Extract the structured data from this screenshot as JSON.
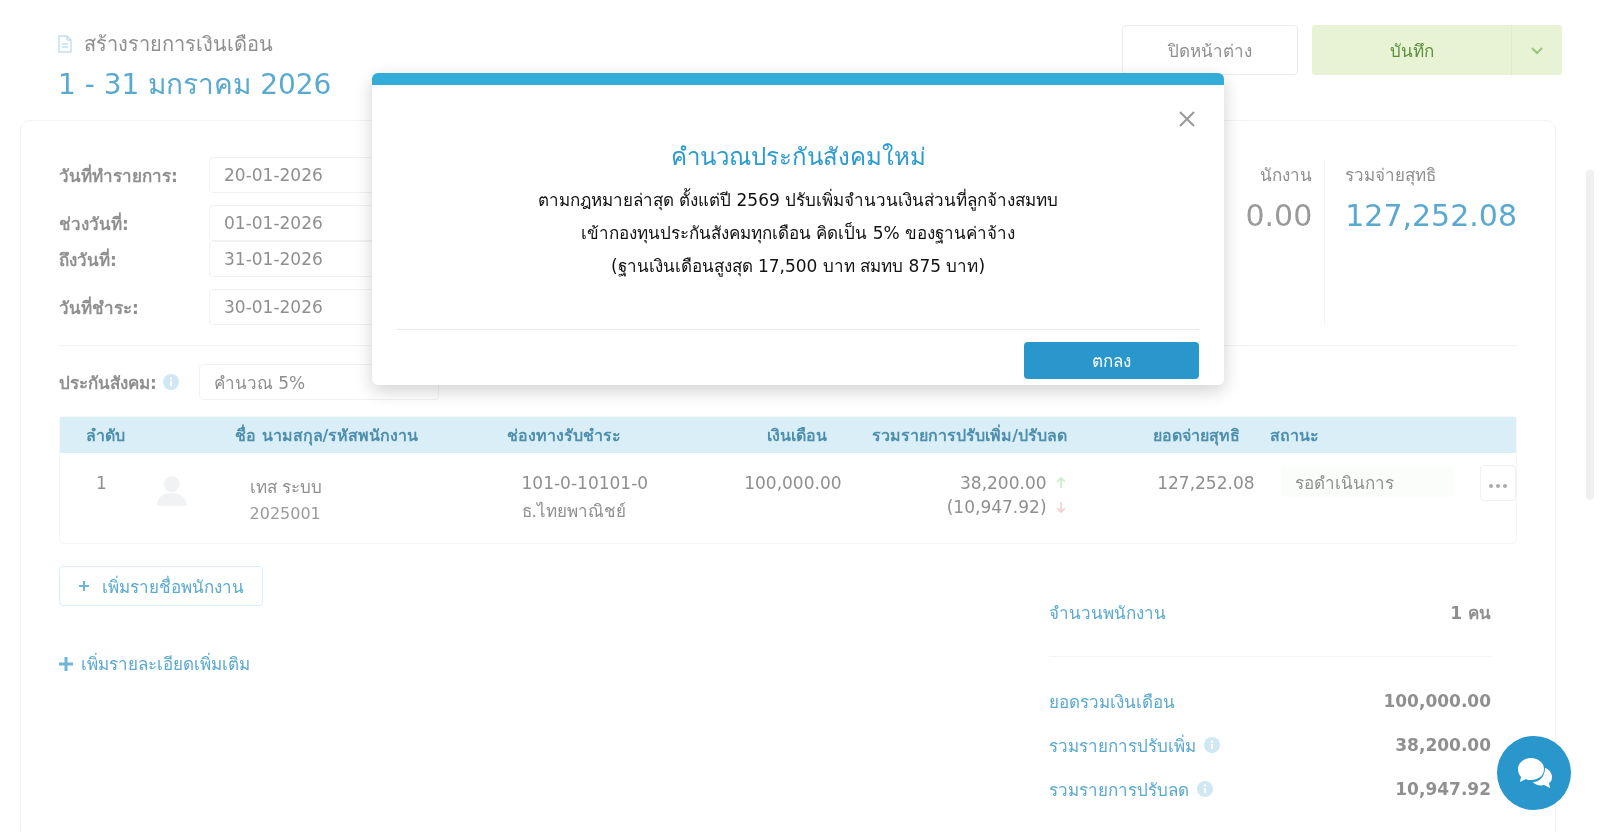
{
  "header": {
    "doc_title": "สร้างรายการเงินเดือน",
    "period": "1 - 31 มกราคม 2026"
  },
  "buttons": {
    "close_label": "ปิดหน้าต่าง",
    "save_label": "บันทึก"
  },
  "form": {
    "fields": [
      {
        "label": "วันที่ทำรายการ:",
        "value": "20-01-2026"
      },
      {
        "label": "ช่วงวันที่:",
        "value": "01-01-2026"
      },
      {
        "label": "ถึงวันที่:",
        "value": "31-01-2026"
      },
      {
        "label": "วันที่ชำระ:",
        "value": "30-01-2026"
      }
    ],
    "social_security": {
      "label": "ประกันสังคม:",
      "value": "คำนวณ 5%"
    }
  },
  "stats": [
    {
      "label": "นักงาน",
      "value": "0.00",
      "highlight": false
    },
    {
      "label": "รวมจ่ายสุทธิ",
      "value": "127,252.08",
      "highlight": true
    }
  ],
  "table": {
    "columns": [
      "ลำดับ",
      "ชื่อ นามสกุล/รหัสพนักงาน",
      "ช่องทางรับชำระ",
      "เงินเดือน",
      "รวมรายการปรับเพิ่ม/ปรับลด",
      "ยอดจ่ายสุทธิ",
      "สถานะ"
    ],
    "rows": [
      {
        "no": "1",
        "name": "เทส ระบบ",
        "code": "2025001",
        "account": "101-0-10101-0",
        "bank": "ธ.ไทยพาณิชย์",
        "salary": "100,000.00",
        "increase": "38,200.00",
        "decrease": "(10,947.92)",
        "net": "127,252.08",
        "status": "รอดำเนินการ"
      }
    ]
  },
  "add_employee_button": "เพิ่มรายชื่อพนักงาน",
  "add_details_link": "เพิ่มรายละเอียดเพิ่มเติม",
  "summary": [
    {
      "label": "จำนวนพนักงาน",
      "value": "1 คน",
      "info": false
    },
    {
      "label": "ยอดรวมเงินเดือน",
      "value": "100,000.00",
      "info": false
    },
    {
      "label": "รวมรายการปรับเพิ่ม",
      "value": "38,200.00",
      "info": true
    },
    {
      "label": "รวมรายการปรับลด",
      "value": "10,947.92",
      "info": true
    }
  ],
  "modal": {
    "title": "คำนวณประกันสังคมใหม่",
    "body_lines": [
      "ตามกฎหมายล่าสุด ตั้งแต่ปี 2569 ปรับเพิ่มจำนวนเงินส่วนที่ลูกจ้างสมทบ",
      "เข้ากองทุนประกันสังคมทุกเดือน คิดเป็น 5% ของฐานค่าจ้าง",
      "(ฐานเงินเดือนสูงสุด 17,500 บาท สมทบ 875 บาท)"
    ],
    "ok_label": "ตกลง"
  }
}
